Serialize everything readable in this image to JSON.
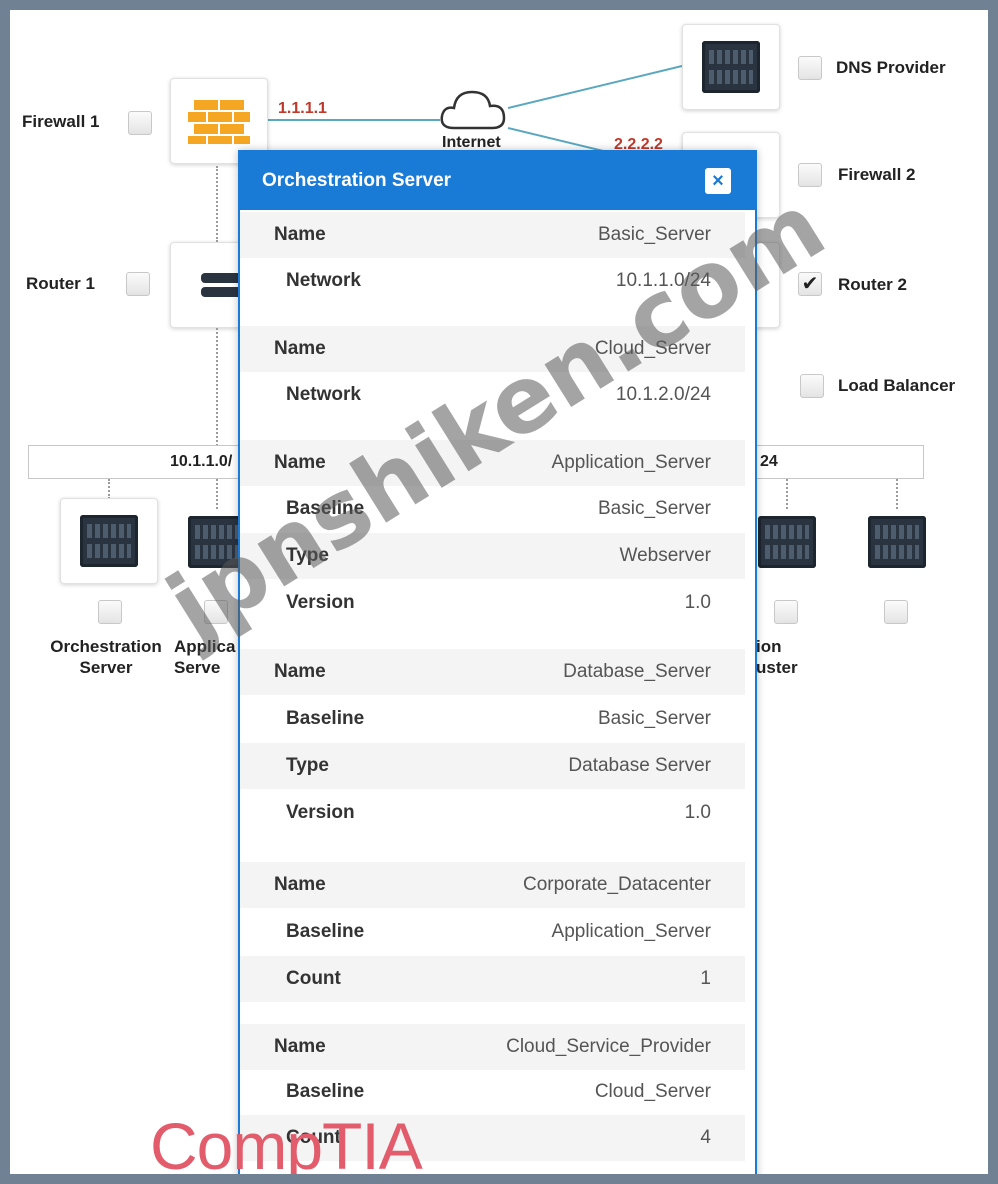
{
  "diagram": {
    "devices": {
      "firewall1": "Firewall 1",
      "dns": "DNS Provider",
      "firewall2": "Firewall 2",
      "router1": "Router 1",
      "router2": "Router 2",
      "load_balancer": "Load Balancer",
      "internet": "Internet"
    },
    "ips": {
      "fw1": "1.1.1.1",
      "fw2": "2.2.2.2"
    },
    "subnets": {
      "left": "10.1.1.0/",
      "right": "24"
    },
    "servers": {
      "orchestration": "Orchestration\nServer",
      "application": "Applica\nServe",
      "right1": "ion\nuster"
    },
    "checks": {
      "router2": "✔"
    }
  },
  "modal": {
    "title": "Orchestration Server",
    "close": "×",
    "rows": [
      {
        "k": "Name",
        "v": "Basic_Server"
      },
      {
        "k": "Network",
        "v": "10.1.1.0/24"
      },
      {
        "k": "Name",
        "v": "Cloud_Server"
      },
      {
        "k": "Network",
        "v": "10.1.2.0/24"
      },
      {
        "k": "Name",
        "v": "Application_Server"
      },
      {
        "k": "Baseline",
        "v": "Basic_Server"
      },
      {
        "k": "Type",
        "v": "Webserver"
      },
      {
        "k": "Version",
        "v": "1.0"
      },
      {
        "k": "Name",
        "v": "Database_Server"
      },
      {
        "k": "Baseline",
        "v": "Basic_Server"
      },
      {
        "k": "Type",
        "v": "Database Server"
      },
      {
        "k": "Version",
        "v": "1.0"
      },
      {
        "k": "Name",
        "v": "Corporate_Datacenter"
      },
      {
        "k": "Baseline",
        "v": "Application_Server"
      },
      {
        "k": "Count",
        "v": "1"
      },
      {
        "k": "Name",
        "v": "Cloud_Service_Provider"
      },
      {
        "k": "Baseline",
        "v": "Cloud_Server"
      },
      {
        "k": "Count",
        "v": "4"
      }
    ]
  },
  "watermark": "jpnshiken.com",
  "brand": "CompTIA"
}
